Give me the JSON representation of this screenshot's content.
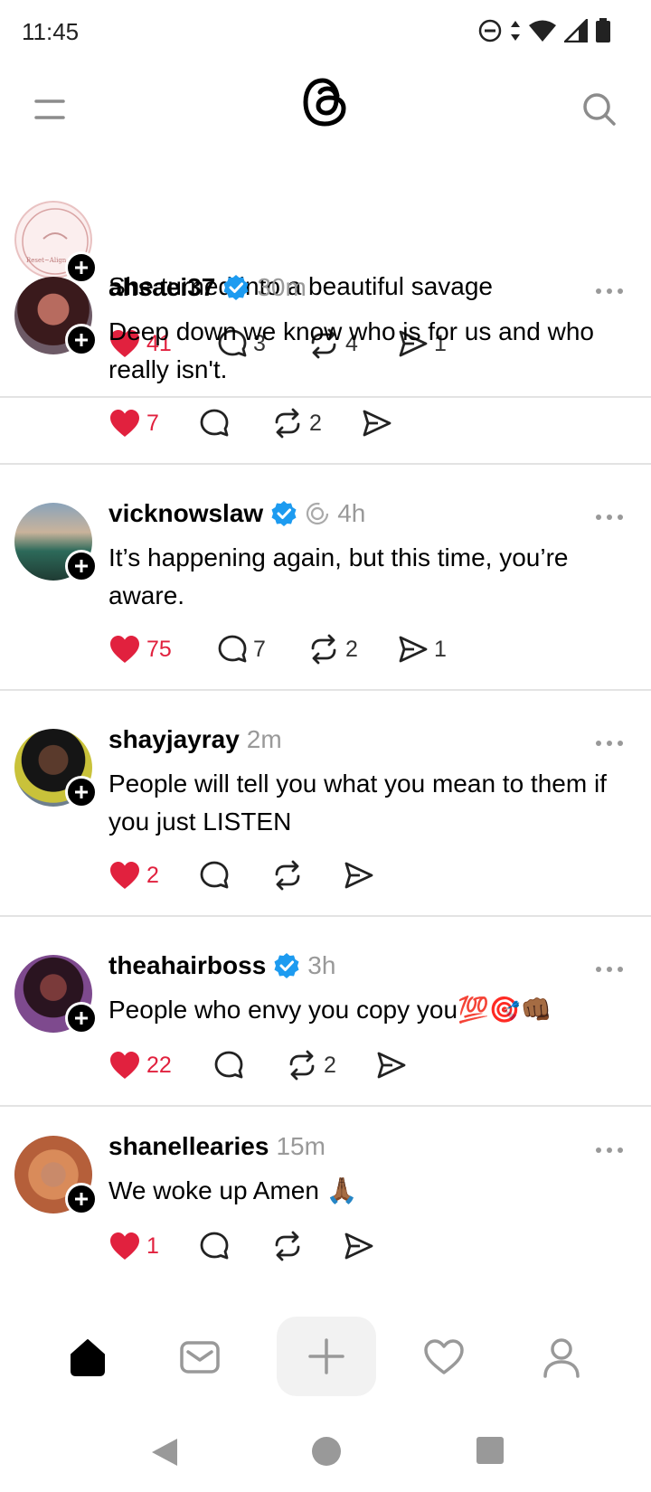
{
  "status_bar": {
    "time": "11:45"
  },
  "partial_post": {
    "text": "She turned into a beautiful savage",
    "likes": "41",
    "replies": "3",
    "reposts": "4",
    "shares": "1",
    "avatar_seal_text": "Reset~Align~Win"
  },
  "posts": [
    {
      "username": "ahsaei37",
      "verified": true,
      "time": "30m",
      "text": "Deep down we know who is for us and who really isn't.",
      "likes": "7",
      "replies": "",
      "reposts": "2",
      "shares": ""
    },
    {
      "username": "vicknowslaw",
      "verified": true,
      "time": "4h",
      "text": "It’s happening again, but this time, you’re aware.",
      "likes": "75",
      "replies": "7",
      "reposts": "2",
      "shares": "1"
    },
    {
      "username": "shayjayray",
      "verified": false,
      "time": "2m",
      "text": "People will tell you what you mean to them if you just LISTEN",
      "likes": "2",
      "replies": "",
      "reposts": "",
      "shares": ""
    },
    {
      "username": "theahairboss",
      "verified": true,
      "time": "3h",
      "text": "People who envy you copy you💯🎯👊🏾",
      "likes": "22",
      "replies": "",
      "reposts": "2",
      "shares": ""
    },
    {
      "username": "shanellearies",
      "verified": false,
      "time": "15m",
      "text": "We woke up Amen 🙏🏾",
      "likes": "1",
      "replies": "",
      "reposts": "",
      "shares": ""
    }
  ],
  "icons": {
    "menu": "menu-icon",
    "logo": "threads-logo",
    "search": "search-icon",
    "heart": "heart-filled-icon",
    "reply": "reply-bubble-icon",
    "repost": "repost-icon",
    "share": "send-icon",
    "more": "more-icon",
    "verified": "verified-badge-icon",
    "follow": "follow-plus-icon"
  },
  "colors": {
    "like": "#e1213e",
    "verified": "#1d9bf0",
    "muted": "#999999"
  }
}
